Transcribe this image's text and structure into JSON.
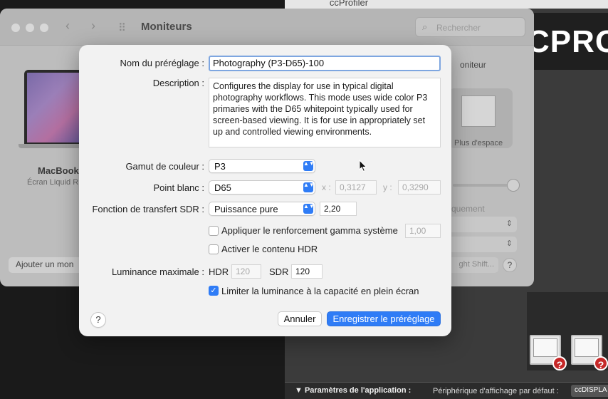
{
  "ccprofiler": {
    "title": "ccProfiler",
    "logo_text": "CPRO",
    "params_label": "▼ Paramètres de l'application :",
    "default_device_label": "Périphérique d'affichage par défaut :",
    "default_device_value": "ccDISPLA"
  },
  "prefs": {
    "window_title": "Moniteurs",
    "search_placeholder": "Rechercher",
    "display_name": "MacBook",
    "display_sub": "Écran Liquid R",
    "add_monitor": "Ajouter un mon",
    "monitor_right": "oniteur",
    "more_space": "Plus d'espace",
    "auto_label": "quement",
    "night_shift": "ght Shift...",
    "help": "?"
  },
  "sheet": {
    "preset_name_label": "Nom du préréglage :",
    "preset_name_value": "Photography (P3-D65)-100",
    "description_label": "Description :",
    "description_text": "Configures the display for use in typical digital photography workflows. This mode uses wide color P3 primaries with the D65 whitepoint typically used for screen-based viewing. It is for use in appropriately set up and controlled viewing environments.",
    "gamut_label": "Gamut de couleur :",
    "gamut_value": "P3",
    "white_point_label": "Point blanc :",
    "white_point_value": "D65",
    "x_label": "x :",
    "x_value": "0,3127",
    "y_label": "y :",
    "y_value": "0,3290",
    "sdr_transfer_label": "Fonction de transfert SDR :",
    "sdr_transfer_value": "Puissance pure",
    "gamma_value": "2,20",
    "apply_gamma_label": "Appliquer le renforcement gamma système",
    "apply_gamma_value": "1,00",
    "apply_gamma_checked": false,
    "enable_hdr_label": "Activer le contenu HDR",
    "enable_hdr_checked": false,
    "max_luminance_label": "Luminance maximale :",
    "hdr_label": "HDR",
    "hdr_value": "120",
    "sdr_label": "SDR",
    "sdr_value": "120",
    "limit_luminance_label": "Limiter la luminance à la capacité en plein écran",
    "limit_luminance_checked": true,
    "help": "?",
    "cancel_label": "Annuler",
    "save_label": "Enregistrer le préréglage",
    "checkmark": "✓",
    "stepper_glyph": "▲▼"
  },
  "colors": {
    "accent": "#2f7cf6",
    "sheet_bg": "#f2f2f2",
    "dimmed_window": "#bdbdbd"
  }
}
